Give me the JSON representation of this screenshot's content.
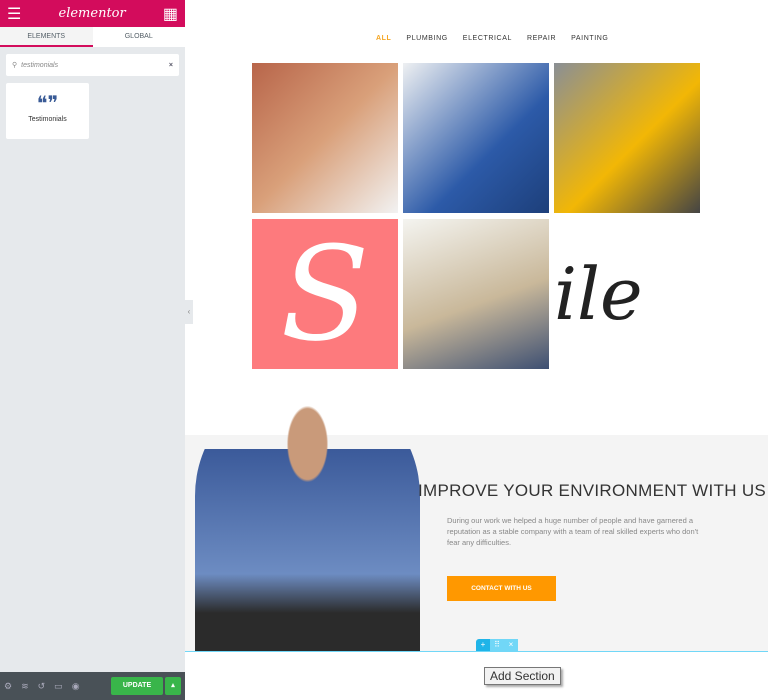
{
  "panel": {
    "logo": "elementor",
    "tabs": [
      "ELEMENTS",
      "GLOBAL"
    ],
    "search_value": "testimonials",
    "widget": "Testimonials",
    "update": "UPDATE"
  },
  "filters": [
    "ALL",
    "PLUMBING",
    "ELECTRICAL",
    "REPAIR",
    "PAINTING"
  ],
  "gallery": {
    "logo_letter": "S",
    "logo_text": "ile"
  },
  "cta": {
    "title": "IMPROVE YOUR ENVIRONMENT WITH US",
    "text": "During our work we helped a huge number of people and have garnered a reputation as a stable company with a team of real skilled experts who don't fear any difficulties.",
    "button": "CONTACT WITH US"
  },
  "editor": {
    "tooltip": "Add Section"
  },
  "colors": {
    "brand": "#d30c5c",
    "accent": "#ff9800",
    "update": "#39b54a"
  }
}
